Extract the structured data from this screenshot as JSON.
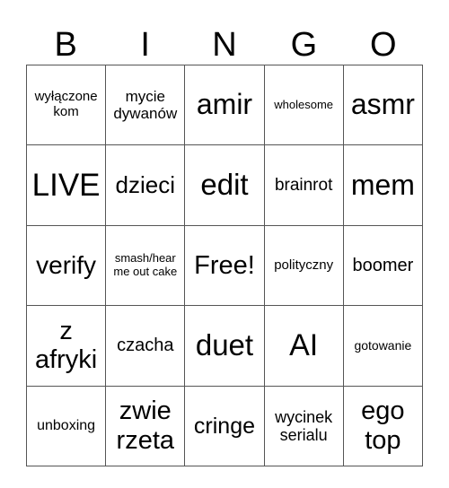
{
  "header": [
    "B",
    "I",
    "N",
    "G",
    "O"
  ],
  "cells": [
    [
      {
        "text": "wyłączone kom",
        "size": 15
      },
      {
        "text": "mycie dywanów",
        "size": 17
      },
      {
        "text": "amir",
        "size": 32
      },
      {
        "text": "wholesome",
        "size": 13
      },
      {
        "text": "asmr",
        "size": 32
      }
    ],
    [
      {
        "text": "LIVE",
        "size": 35
      },
      {
        "text": "dzieci",
        "size": 26
      },
      {
        "text": "edit",
        "size": 33
      },
      {
        "text": "brainrot",
        "size": 19
      },
      {
        "text": "mem",
        "size": 32
      }
    ],
    [
      {
        "text": "verify",
        "size": 28
      },
      {
        "text": "smash/hear me out cake",
        "size": 13
      },
      {
        "text": "Free!",
        "size": 29
      },
      {
        "text": "polityczny",
        "size": 15
      },
      {
        "text": "boomer",
        "size": 20
      }
    ],
    [
      {
        "text": "z afryki",
        "size": 29
      },
      {
        "text": "czacha",
        "size": 20
      },
      {
        "text": "duet",
        "size": 33
      },
      {
        "text": "AI",
        "size": 34
      },
      {
        "text": "gotowanie",
        "size": 14
      }
    ],
    [
      {
        "text": "unboxing",
        "size": 16
      },
      {
        "text": "zwie rzeta",
        "size": 29
      },
      {
        "text": "cringe",
        "size": 25
      },
      {
        "text": "wycinek serialu",
        "size": 18
      },
      {
        "text": "ego top",
        "size": 29
      }
    ]
  ]
}
